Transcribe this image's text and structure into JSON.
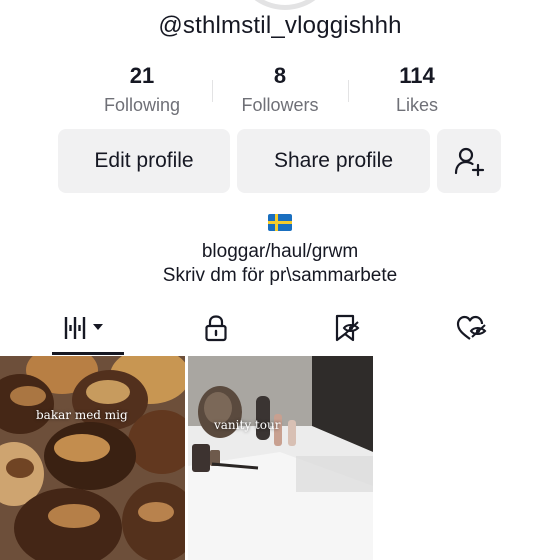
{
  "profile": {
    "handle": "@sthlmstil_vloggishhh"
  },
  "stats": [
    {
      "value": "21",
      "label": "Following"
    },
    {
      "value": "8",
      "label": "Followers"
    },
    {
      "value": "114",
      "label": "Likes"
    }
  ],
  "actions": {
    "edit_label": "Edit profile",
    "share_label": "Share profile",
    "add_friend_icon": "person-plus-icon"
  },
  "bio": {
    "flag_icon": "sweden-flag-icon",
    "line1": "bloggar/haul/grwm",
    "line2": "Skriv dm för pr\\sammarbete"
  },
  "tabs": [
    {
      "icon": "videos-grid-icon",
      "active": true
    },
    {
      "icon": "lock-icon",
      "active": false
    },
    {
      "icon": "bookmark-icon",
      "active": false
    },
    {
      "icon": "liked-heart-icon",
      "active": false
    }
  ],
  "videos": [
    {
      "caption": "bakar med mig"
    },
    {
      "caption": "vanity tour"
    }
  ],
  "colors": {
    "text_primary": "#161823",
    "text_secondary": "#6f7077",
    "button_bg": "#f1f1f2",
    "divider": "#e3e3e4"
  }
}
